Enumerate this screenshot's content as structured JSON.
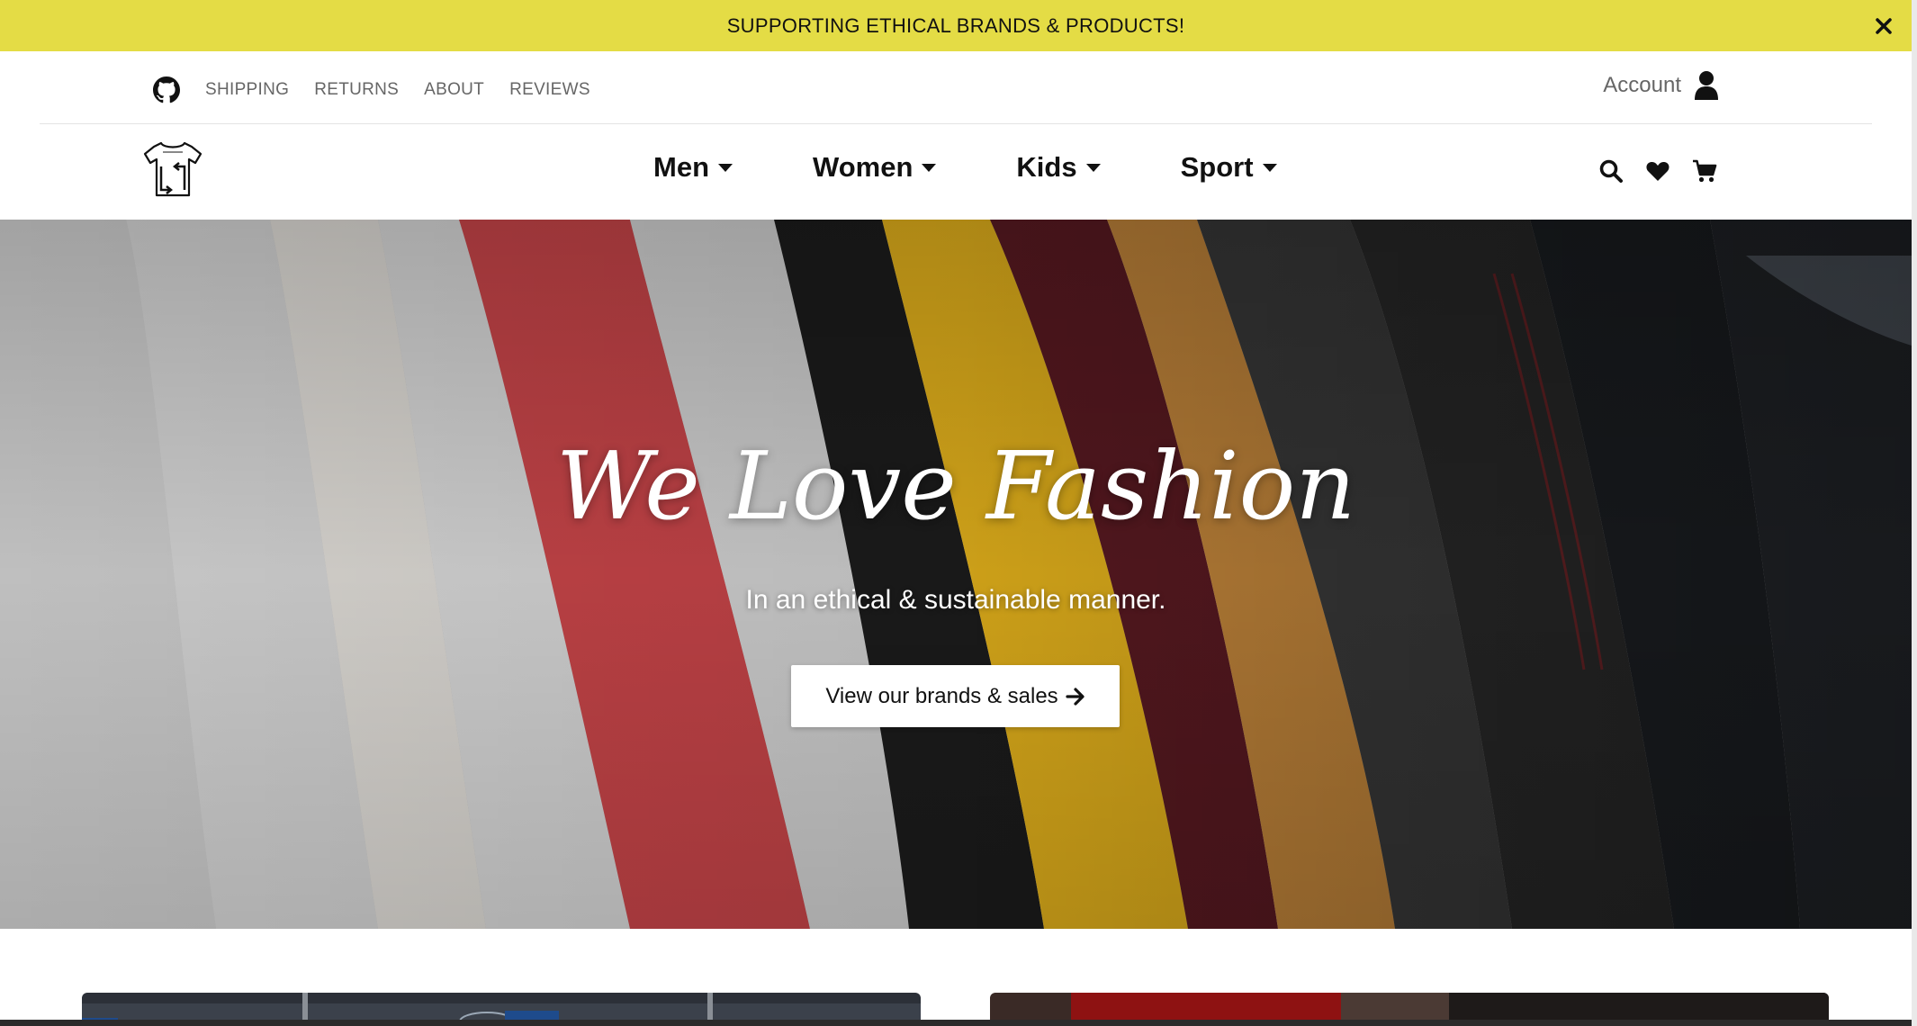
{
  "announcement": {
    "text": "SUPPORTING ETHICAL BRANDS & PRODUCTS!"
  },
  "utility_nav": {
    "links": [
      "SHIPPING",
      "RETURNS",
      "ABOUT",
      "REVIEWS"
    ],
    "account_label": "Account"
  },
  "main_nav": {
    "menu": [
      {
        "label": "Men"
      },
      {
        "label": "Women"
      },
      {
        "label": "Kids"
      },
      {
        "label": "Sport"
      }
    ],
    "icons": [
      "search-icon",
      "heart-icon",
      "cart-icon"
    ]
  },
  "hero": {
    "title": "We Love Fashion",
    "subtitle": "In an ethical & sustainable manner.",
    "cta_label": "View our brands & sales"
  },
  "colors": {
    "announcement_bg": "#e4dc45",
    "text_dark": "#111111",
    "muted": "#666666"
  }
}
